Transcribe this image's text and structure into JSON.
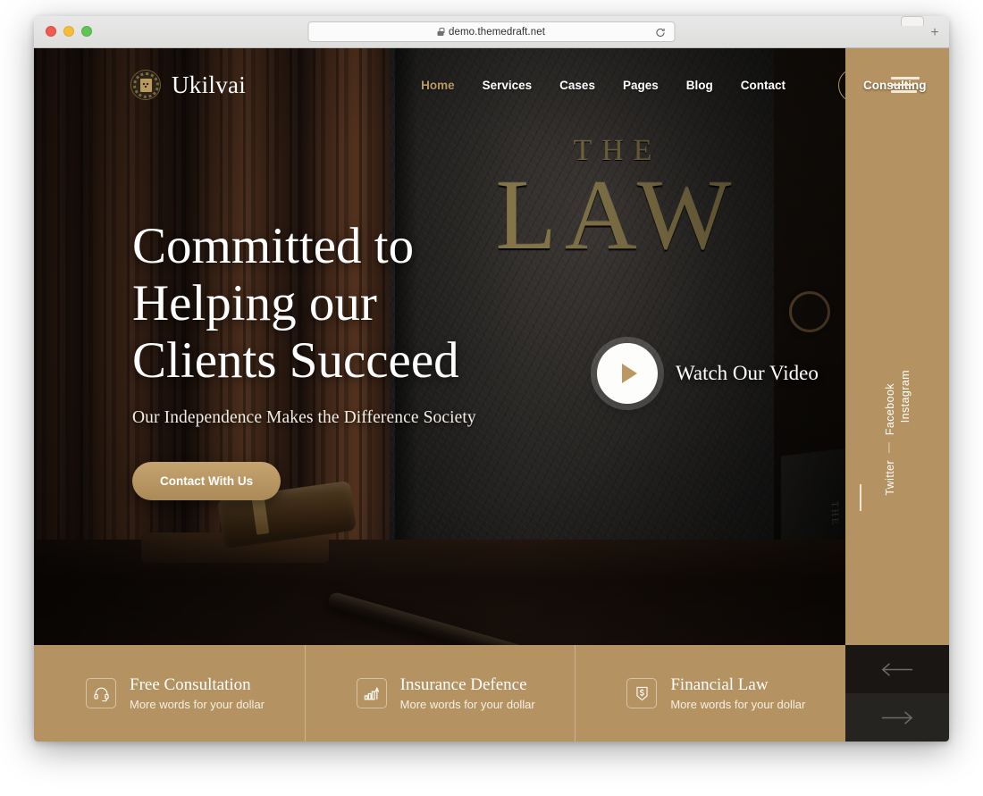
{
  "browser": {
    "url": "demo.themedraft.net",
    "lock_icon": "lock-icon",
    "reload_icon": "reload-icon",
    "newtab_label": "+",
    "traffic_lights": [
      "close",
      "minimize",
      "zoom"
    ]
  },
  "header": {
    "logo_icon": "laurel-emblem-icon",
    "brand": "Ukilvai",
    "nav": [
      {
        "label": "Home",
        "active": true
      },
      {
        "label": "Services",
        "active": false
      },
      {
        "label": "Cases",
        "active": false
      },
      {
        "label": "Pages",
        "active": false
      },
      {
        "label": "Blog",
        "active": false
      },
      {
        "label": "Contact",
        "active": false
      }
    ],
    "cta_label": "Consulting",
    "menu_icon": "hamburger-menu-icon"
  },
  "hero": {
    "background_book_top": "THE",
    "background_book_title": "LAW",
    "headline_line1": "Committed to",
    "headline_line2": "Helping our",
    "headline_line3": "Clients Succeed",
    "subtitle": "Our Independence Makes the Difference Society",
    "cta_label": "Contact With Us",
    "video_label": "Watch Our Video",
    "play_icon": "play-icon"
  },
  "social_rail": {
    "separator": "—",
    "links": [
      {
        "label": "Facebook"
      },
      {
        "label": "Twitter"
      },
      {
        "label": "Instagram"
      }
    ]
  },
  "features": [
    {
      "icon": "headset-icon",
      "title": "Free Consultation",
      "subtitle": "More words for your dollar"
    },
    {
      "icon": "growth-chart-icon",
      "title": "Insurance Defence",
      "subtitle": "More words for your dollar"
    },
    {
      "icon": "dollar-shield-icon",
      "title": "Financial Law",
      "subtitle": "More words for your dollar"
    }
  ],
  "slider_controls": {
    "prev_icon": "arrow-left-icon",
    "next_icon": "arrow-right-icon"
  },
  "colors": {
    "accent_tan": "#b49261",
    "gold_text": "#b99a63",
    "book_gold": "#9c8a56",
    "dark_panel": "#191613"
  }
}
